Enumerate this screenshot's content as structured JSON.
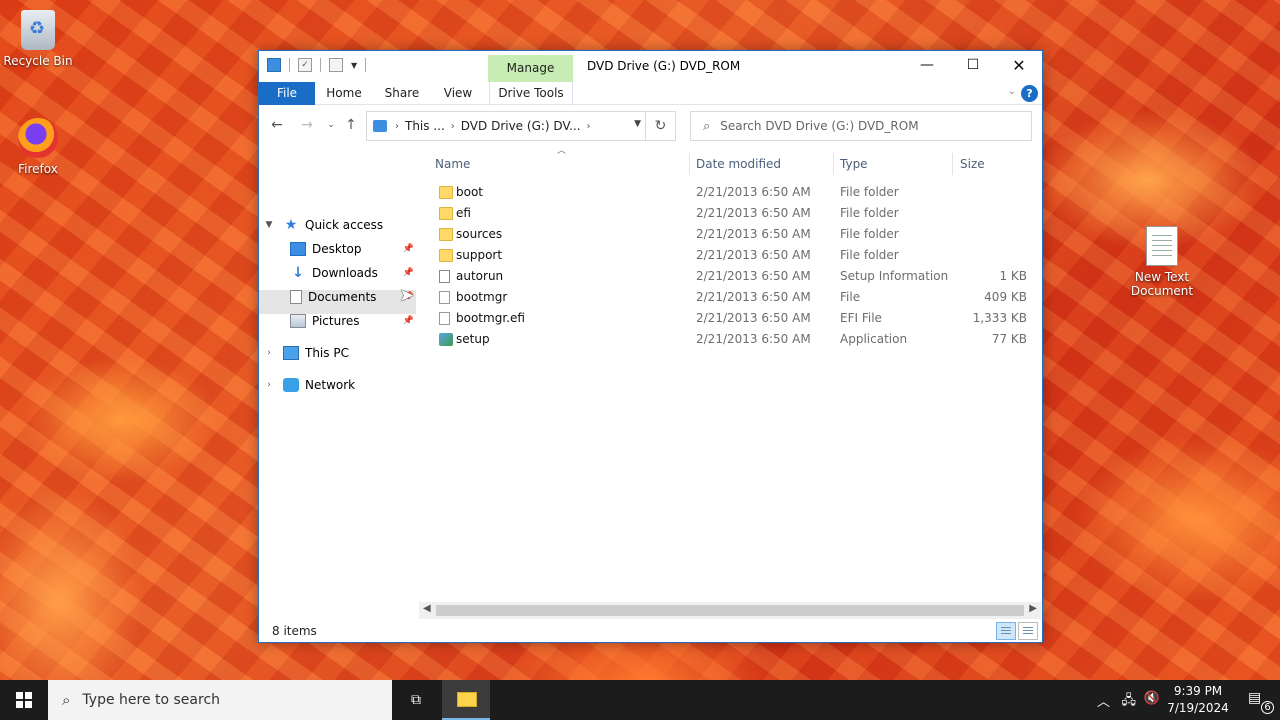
{
  "desktop": {
    "icons": [
      {
        "label": "Recycle Bin"
      },
      {
        "label": "Firefox"
      },
      {
        "label": "New Text Document"
      }
    ]
  },
  "window": {
    "title": "DVD Drive (G:) DVD_ROM",
    "contextual_tab": "Manage",
    "controls": {
      "minimize": "—",
      "maximize": "☐",
      "close": "✕"
    }
  },
  "ribbon": {
    "tabs": [
      "File",
      "Home",
      "Share",
      "View",
      "Drive Tools"
    ]
  },
  "address": {
    "segments": [
      "This ...",
      "DVD Drive (G:) DV..."
    ],
    "search_placeholder": "Search DVD Drive (G:) DVD_ROM"
  },
  "nav": {
    "quick_access": "Quick access",
    "items": [
      {
        "label": "Desktop"
      },
      {
        "label": "Downloads"
      },
      {
        "label": "Documents"
      },
      {
        "label": "Pictures"
      }
    ],
    "this_pc": "This PC",
    "network": "Network"
  },
  "columns": {
    "name": "Name",
    "date": "Date modified",
    "type": "Type",
    "size": "Size"
  },
  "files": [
    {
      "name": "boot",
      "date": "2/21/2013 6:50 AM",
      "type": "File folder",
      "size": "",
      "icon": "folder"
    },
    {
      "name": "efi",
      "date": "2/21/2013 6:50 AM",
      "type": "File folder",
      "size": "",
      "icon": "folder"
    },
    {
      "name": "sources",
      "date": "2/21/2013 6:50 AM",
      "type": "File folder",
      "size": "",
      "icon": "folder"
    },
    {
      "name": "support",
      "date": "2/21/2013 6:50 AM",
      "type": "File folder",
      "size": "",
      "icon": "folder"
    },
    {
      "name": "autorun",
      "date": "2/21/2013 6:50 AM",
      "type": "Setup Information",
      "size": "1 KB",
      "icon": "inf"
    },
    {
      "name": "bootmgr",
      "date": "2/21/2013 6:50 AM",
      "type": "File",
      "size": "409 KB",
      "icon": "file"
    },
    {
      "name": "bootmgr.efi",
      "date": "2/21/2013 6:50 AM",
      "type": "EFI File",
      "size": "1,333 KB",
      "icon": "file"
    },
    {
      "name": "setup",
      "date": "2/21/2013 6:50 AM",
      "type": "Application",
      "size": "77 KB",
      "icon": "setup"
    }
  ],
  "status": {
    "item_count": "8 items"
  },
  "taskbar": {
    "search_placeholder": "Type here to search",
    "time": "9:39 PM",
    "date": "7/19/2024",
    "notification_count": "6"
  }
}
